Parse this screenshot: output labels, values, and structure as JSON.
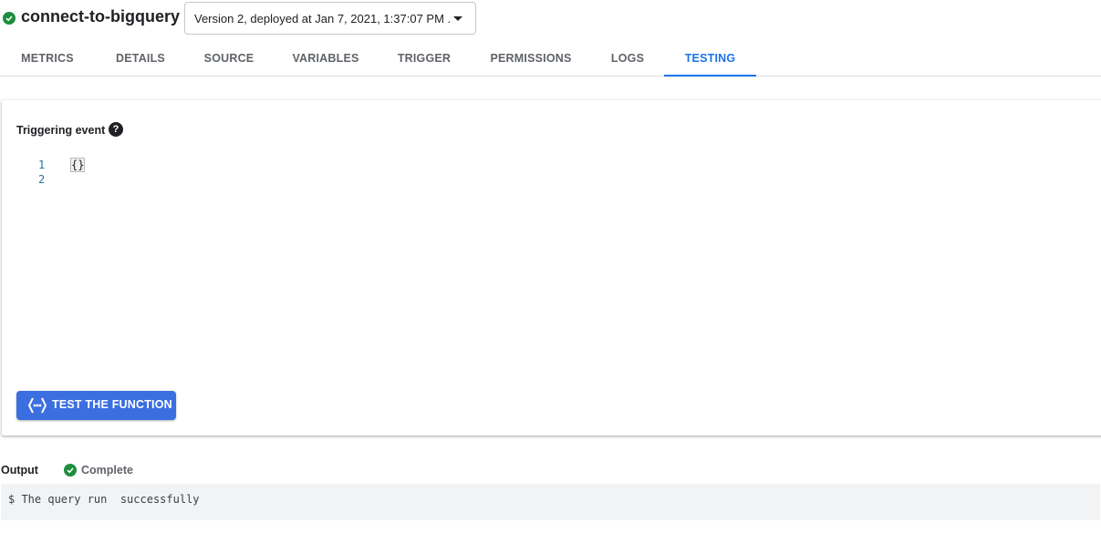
{
  "header": {
    "status_icon": "check-circle-icon",
    "function_name": "connect-to-bigquery",
    "version_selected": "Version 2, deployed at Jan 7, 2021, 1:37:07 PM ..."
  },
  "tabs": [
    {
      "label": "METRICS"
    },
    {
      "label": "DETAILS"
    },
    {
      "label": "SOURCE"
    },
    {
      "label": "VARIABLES"
    },
    {
      "label": "TRIGGER"
    },
    {
      "label": "PERMISSIONS"
    },
    {
      "label": "LOGS"
    },
    {
      "label": "TESTING",
      "active": true
    }
  ],
  "testing": {
    "triggering_event_label": "Triggering event",
    "help_icon": "help-icon",
    "editor": {
      "line_numbers": [
        "1",
        "2"
      ],
      "lines": [
        "{}",
        ""
      ]
    },
    "test_button_label": "TEST THE FUNCTION",
    "test_button_icon": "cloud-functions-icon"
  },
  "output": {
    "label": "Output",
    "status": "Complete",
    "status_icon": "check-circle-icon",
    "console_text": "$ The query run  successfully"
  },
  "colors": {
    "accent": "#1a73e8",
    "button": "#3b6fe0",
    "success": "#1e8e3e"
  }
}
